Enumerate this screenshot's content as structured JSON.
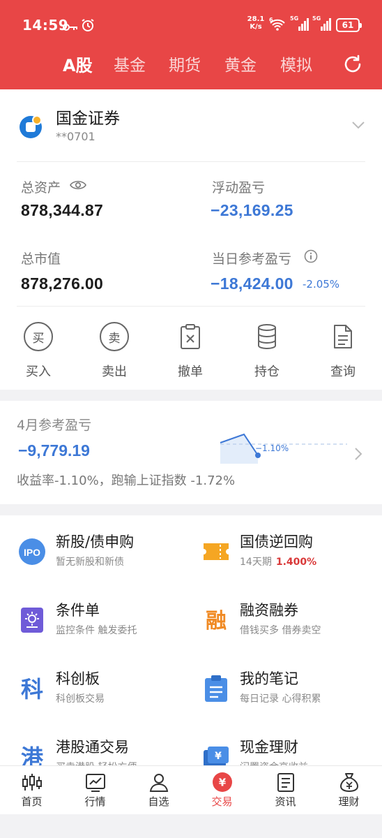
{
  "status_bar": {
    "time": "14:59",
    "net_speed_value": "28.1",
    "net_speed_unit": "K/s",
    "wifi_label": "6",
    "signal1_label": "5G",
    "signal2_label": "5G",
    "battery": "61"
  },
  "tabs": [
    {
      "label": "A股",
      "active": true
    },
    {
      "label": "基金"
    },
    {
      "label": "期货"
    },
    {
      "label": "黄金"
    },
    {
      "label": "模拟"
    }
  ],
  "account": {
    "broker_name": "国金证券",
    "account_no": "**0701",
    "total_assets_label": "总资产",
    "total_assets_value": "878,344.87",
    "floating_pl_label": "浮动盈亏",
    "floating_pl_value": "−23,169.25",
    "market_value_label": "总市值",
    "market_value_value": "878,276.00",
    "daily_pl_label": "当日参考盈亏",
    "daily_pl_value": "−18,424.00",
    "daily_pl_pct": "-2.05%"
  },
  "actions": [
    {
      "label": "买入",
      "glyph": "买",
      "icon": "buy-icon"
    },
    {
      "label": "卖出",
      "glyph": "卖",
      "icon": "sell-icon"
    },
    {
      "label": "撤单",
      "icon": "cancel-order-icon"
    },
    {
      "label": "持仓",
      "icon": "position-icon"
    },
    {
      "label": "查询",
      "icon": "query-icon"
    }
  ],
  "monthly": {
    "title": "4月参考盈亏",
    "value": "−9,779.19",
    "description": "收益率-1.10%，跑输上证指数 -1.72%",
    "chart_marker": "−1.10%"
  },
  "services": [
    {
      "title": "新股/债申购",
      "subtitle": "暂无新股和新债",
      "icon": "ipo-icon",
      "icon_text": "IPO"
    },
    {
      "title": "国债逆回购",
      "subtitle": "14天期",
      "highlight": "1.400%",
      "icon": "ticket-icon"
    },
    {
      "title": "条件单",
      "subtitle": "监控条件 触发委托",
      "icon": "condition-order-icon"
    },
    {
      "title": "融资融券",
      "subtitle": "借钱买多 借券卖空",
      "icon": "margin-icon",
      "icon_text": "融"
    },
    {
      "title": "科创板",
      "subtitle": "科创板交易",
      "icon": "star-market-icon",
      "icon_text": "科"
    },
    {
      "title": "我的笔记",
      "subtitle": "每日记录 心得积累",
      "icon": "notes-icon"
    },
    {
      "title": "港股通交易",
      "subtitle": "买卖港股 轻松方便",
      "icon": "hk-connect-icon",
      "icon_text": "港"
    },
    {
      "title": "现金理财",
      "subtitle": "闲置资金高收益",
      "icon": "cash-icon",
      "icon_text": "¥"
    }
  ],
  "bottom_nav": [
    {
      "label": "首页",
      "icon": "home-candlestick-icon"
    },
    {
      "label": "行情",
      "icon": "market-chart-icon"
    },
    {
      "label": "自选",
      "icon": "watchlist-icon"
    },
    {
      "label": "交易",
      "icon": "trade-icon",
      "active": true,
      "icon_text": "¥"
    },
    {
      "label": "资讯",
      "icon": "news-icon"
    },
    {
      "label": "理财",
      "icon": "wealth-icon"
    }
  ],
  "colors": {
    "brand_red": "#e84646",
    "loss_blue": "#3d78d6",
    "highlight_red": "#d93a3a",
    "ipo_blue": "#4a8ee6",
    "ticket_orange": "#f5a623"
  }
}
